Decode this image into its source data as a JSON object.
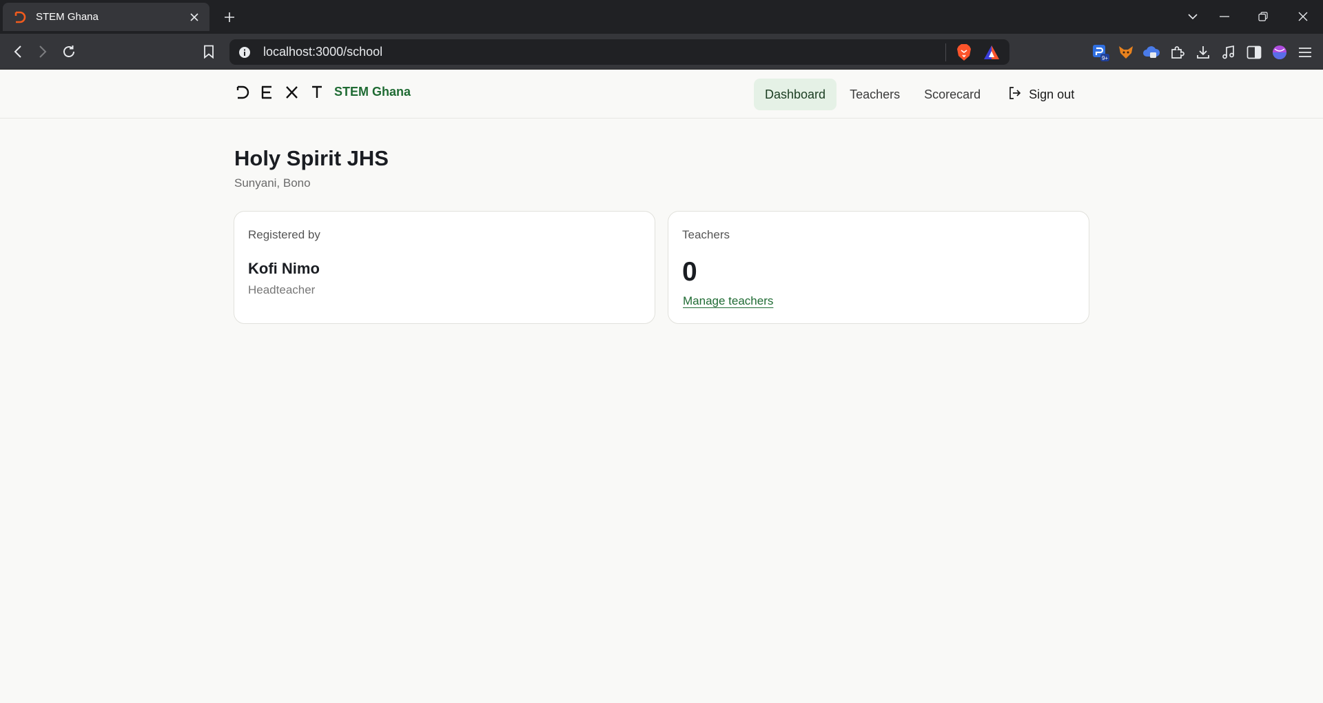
{
  "browser": {
    "tab": {
      "title": "STEM Ghana",
      "favicon": "dext-d-icon"
    },
    "url": "localhost:3000/school",
    "icons": {
      "back": "back-arrow-icon",
      "forward": "forward-arrow-icon",
      "reload": "reload-icon",
      "bookmark": "bookmark-icon",
      "brave": "brave-lion-icon",
      "rewards": "brave-rewards-triangle-icon"
    },
    "extension_badge": "9+"
  },
  "header": {
    "logo": "DEXT",
    "brand": "STEM Ghana",
    "nav": [
      {
        "label": "Dashboard",
        "active": true
      },
      {
        "label": "Teachers",
        "active": false
      },
      {
        "label": "Scorecard",
        "active": false
      }
    ],
    "signout_label": "Sign out"
  },
  "school": {
    "name": "Holy Spirit JHS",
    "location": "Sunyani, Bono"
  },
  "cards": {
    "registered": {
      "label": "Registered by",
      "name": "Kofi Nimo",
      "role": "Headteacher"
    },
    "teachers": {
      "label": "Teachers",
      "count": "0",
      "link": "Manage teachers"
    }
  },
  "colors": {
    "brand_green": "#1f6b33",
    "active_nav_bg": "#e5f1e6",
    "page_bg": "#f9f9f7"
  }
}
